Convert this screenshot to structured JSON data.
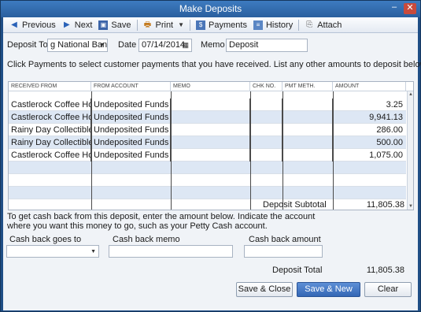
{
  "window": {
    "title": "Make Deposits",
    "minimize_label": "–",
    "close_label": "✕"
  },
  "toolbar": {
    "previous": "Previous",
    "next": "Next",
    "save": "Save",
    "print": "Print",
    "payments": "Payments",
    "history": "History",
    "attach": "Attach"
  },
  "header": {
    "deposit_to_label": "Deposit To",
    "deposit_to_value": "g National Bank",
    "date_label": "Date",
    "date_value": "07/14/2014",
    "memo_label": "Memo",
    "memo_value": "Deposit",
    "instructions": "Click Payments to select customer payments that you have received. List any other amounts to deposit below."
  },
  "table": {
    "columns": [
      "RECEIVED FROM",
      "FROM ACCOUNT",
      "MEMO",
      "CHK NO.",
      "PMT METH.",
      "AMOUNT"
    ],
    "rows": [
      {
        "received_from": "Castlerock Coffee House",
        "from_account": "Undeposited Funds",
        "memo": "",
        "chk_no": "",
        "pmt_meth": "",
        "amount": "3.25"
      },
      {
        "received_from": "Castlerock Coffee House",
        "from_account": "Undeposited Funds",
        "memo": "",
        "chk_no": "",
        "pmt_meth": "",
        "amount": "9,941.13"
      },
      {
        "received_from": "Rainy Day Collectibles",
        "from_account": "Undeposited Funds",
        "memo": "",
        "chk_no": "",
        "pmt_meth": "",
        "amount": "286.00"
      },
      {
        "received_from": "Rainy Day Collectibles",
        "from_account": "Undeposited Funds",
        "memo": "",
        "chk_no": "",
        "pmt_meth": "",
        "amount": "500.00"
      },
      {
        "received_from": "Castlerock Coffee House",
        "from_account": "Undeposited Funds",
        "memo": "",
        "chk_no": "",
        "pmt_meth": "",
        "amount": "1,075.00"
      }
    ]
  },
  "subtotal": {
    "label": "Deposit Subtotal",
    "value": "11,805.38"
  },
  "cashback": {
    "instructions_line1": "To get cash back from this deposit, enter the amount below.  Indicate the account",
    "instructions_line2": "where you want this money to go, such as your Petty Cash account.",
    "goes_to_label": "Cash back goes to",
    "goes_to_value": "",
    "memo_label": "Cash back memo",
    "memo_value": "",
    "amount_label": "Cash back amount",
    "amount_value": ""
  },
  "total": {
    "label": "Deposit Total",
    "value": "11,805.38"
  },
  "buttons": {
    "save_close": "Save & Close",
    "save_new": "Save & New",
    "clear": "Clear"
  },
  "colors": {
    "title_bar": "#2f6aae",
    "primary_button": "#3f75c4",
    "row_alt": "#dde7f4"
  }
}
